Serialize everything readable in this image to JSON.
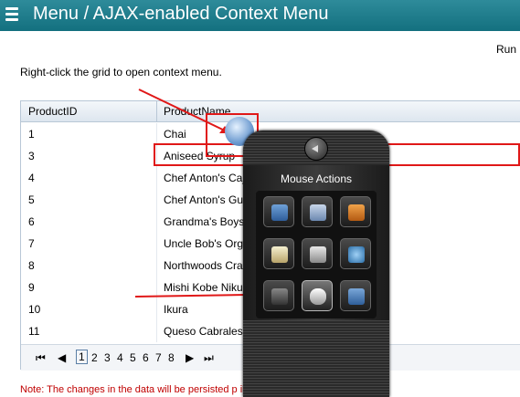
{
  "window": {
    "title": "Menu / AJAX-enabled Context Menu"
  },
  "toolbar": {
    "run_label": "Run"
  },
  "instructions": "Right-click the grid to open context menu.",
  "grid": {
    "columns": [
      "ProductID",
      "ProductName"
    ],
    "rows": [
      {
        "id": "1",
        "name": "Chai"
      },
      {
        "id": "3",
        "name": "Aniseed Syrup"
      },
      {
        "id": "4",
        "name": "Chef Anton's Caj"
      },
      {
        "id": "5",
        "name": "Chef Anton's Gum"
      },
      {
        "id": "6",
        "name": "Grandma's Boyse"
      },
      {
        "id": "7",
        "name": "Uncle Bob's Orga"
      },
      {
        "id": "8",
        "name": "Northwoods Cran"
      },
      {
        "id": "9",
        "name": "Mishi Kobe Niku"
      },
      {
        "id": "10",
        "name": "Ikura"
      },
      {
        "id": "11",
        "name": "Queso Cabrales"
      }
    ]
  },
  "pager": {
    "first": "⏮",
    "prev": "◀",
    "next": "▶",
    "last": "⏭",
    "pages": [
      "1",
      "2",
      "3",
      "4",
      "5",
      "6",
      "7",
      "8"
    ],
    "current": "1"
  },
  "context_menu": {
    "title": "Mouse Actions",
    "icons": [
      "grid-edit-icon",
      "tree-list-icon",
      "3d-stack-icon",
      "pencil-note-icon",
      "lightning-icon",
      "globe-cursor-icon",
      "javascript-icon",
      "mouse-icon",
      "dotted-frame-icon"
    ],
    "selected_icon": "mouse-icon"
  },
  "note": "Note: The changes in the data will be persisted p                                          ill be reset next time you visit",
  "colors": {
    "accent": "#13707f",
    "annotation": "#e01818",
    "note": "#c00000"
  }
}
